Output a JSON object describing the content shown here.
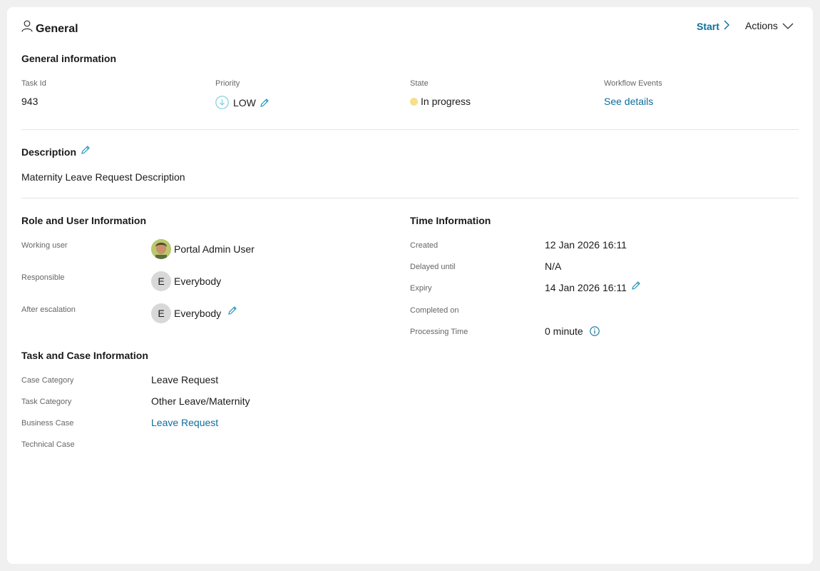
{
  "header": {
    "title": "General",
    "start_label": "Start",
    "actions_label": "Actions"
  },
  "general": {
    "heading": "General information",
    "task_id": {
      "label": "Task Id",
      "value": "943"
    },
    "priority": {
      "label": "Priority",
      "value": "LOW"
    },
    "state": {
      "label": "State",
      "value": "In progress",
      "color": "#f6e08a"
    },
    "workflow": {
      "label": "Workflow Events",
      "link": "See details"
    }
  },
  "description": {
    "heading": "Description",
    "text": "Maternity Leave Request Description"
  },
  "role": {
    "heading": "Role and User Information",
    "working_user": {
      "label": "Working user",
      "value": "Portal Admin User"
    },
    "responsible": {
      "label": "Responsible",
      "initial": "E",
      "value": "Everybody"
    },
    "after_escalation": {
      "label": "After escalation",
      "initial": "E",
      "value": "Everybody"
    }
  },
  "time": {
    "heading": "Time Information",
    "created": {
      "label": "Created",
      "value": "12 Jan 2026 16:11"
    },
    "delayed": {
      "label": "Delayed until",
      "value": "N/A"
    },
    "expiry": {
      "label": "Expiry",
      "value": "14 Jan 2026 16:11"
    },
    "completed": {
      "label": "Completed on",
      "value": ""
    },
    "processing": {
      "label": "Processing Time",
      "value": "0 minute"
    }
  },
  "task_case": {
    "heading": "Task and Case Information",
    "case_category": {
      "label": "Case Category",
      "value": "Leave Request"
    },
    "task_category": {
      "label": "Task Category",
      "value": "Other Leave/Maternity"
    },
    "business_case": {
      "label": "Business Case",
      "link": "Leave Request"
    },
    "technical_case": {
      "label": "Technical Case",
      "value": ""
    }
  },
  "colors": {
    "accent": "#0d6e9c",
    "edit_icon": "#1a8fb8",
    "priority_icon": "#7fcfe0"
  }
}
